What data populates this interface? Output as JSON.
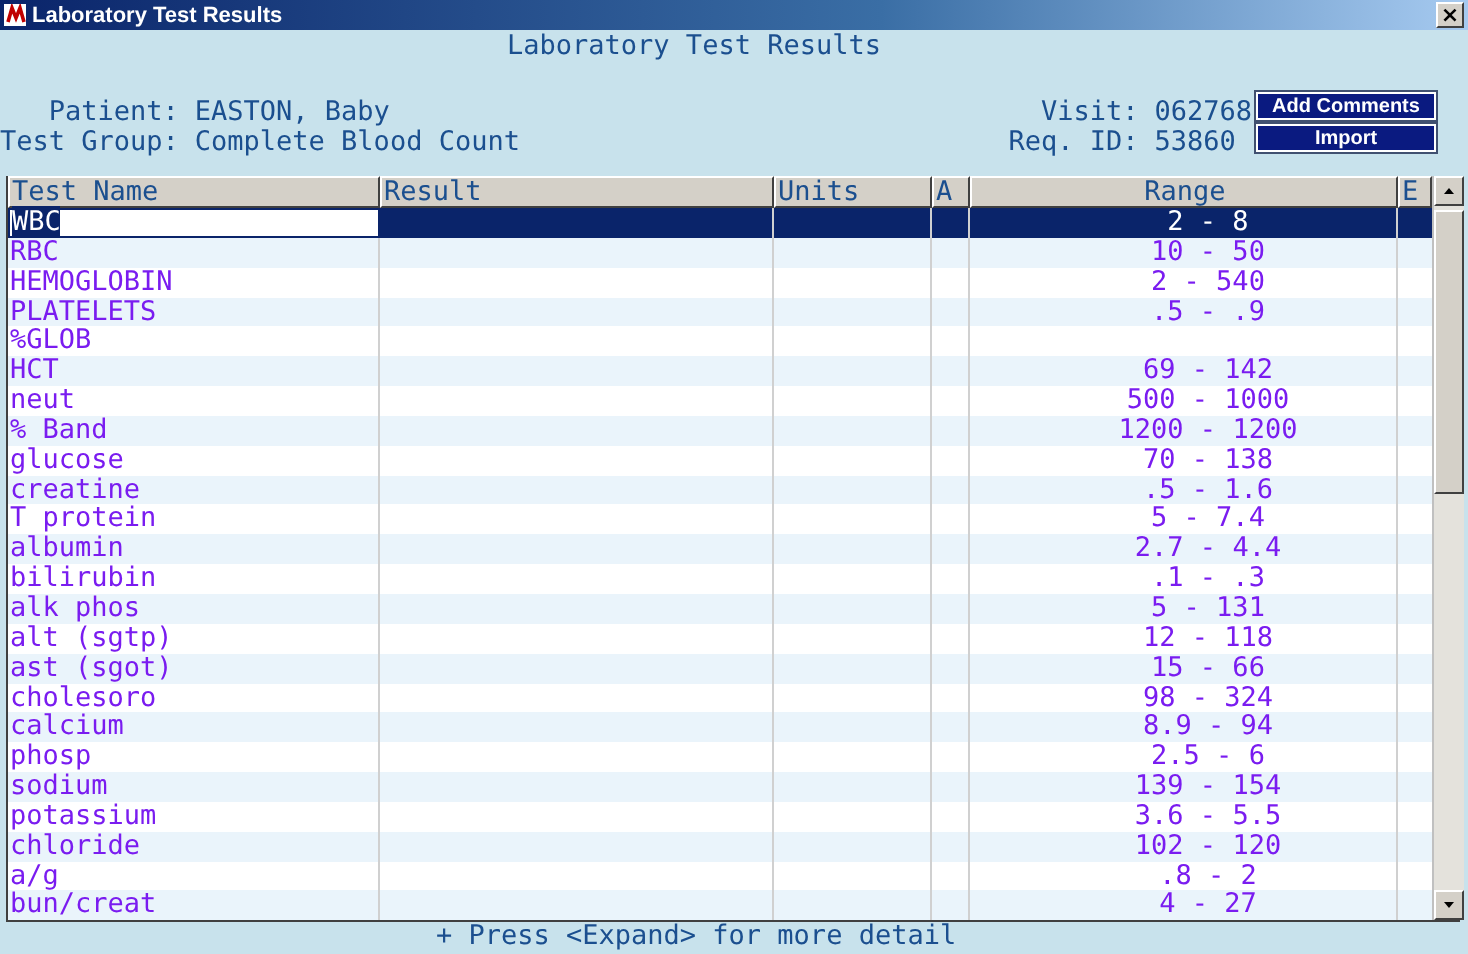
{
  "window": {
    "title": "Laboratory Test Results",
    "close": "×"
  },
  "header": {
    "title": "Laboratory Test Results",
    "patient_label": "Patient:",
    "patient": "EASTON, Baby",
    "group_label": "Test Group:",
    "group": "Complete Blood Count",
    "visit_label": "Visit:",
    "visit": "062768",
    "req_label": "Req. ID:",
    "req": "53860"
  },
  "buttons": [
    {
      "label": "Add Comments"
    },
    {
      "label": "Import"
    }
  ],
  "table": {
    "columns": [
      "Test Name",
      "Result",
      "Units",
      "A",
      "Range",
      "E"
    ],
    "rows": [
      {
        "name": "WBC",
        "range": "2 - 8",
        "selected": true
      },
      {
        "name": "RBC",
        "range": "10 - 50",
        "selected": false
      },
      {
        "name": "HEMOGLOBIN",
        "range": "2 - 540",
        "selected": false
      },
      {
        "name": "PLATELETS",
        "range": ".5 - .9",
        "selected": false
      },
      {
        "name": "%GLOB",
        "range": "",
        "selected": false
      },
      {
        "name": "HCT",
        "range": "69 - 142",
        "selected": false
      },
      {
        "name": "neut",
        "range": "500 - 1000",
        "selected": false
      },
      {
        "name": "% Band",
        "range": "1200 - 1200",
        "selected": false
      },
      {
        "name": "glucose",
        "range": "70 - 138",
        "selected": false
      },
      {
        "name": "creatine",
        "range": ".5 - 1.6",
        "selected": false
      },
      {
        "name": "T protein",
        "range": "5 - 7.4",
        "selected": false
      },
      {
        "name": "albumin",
        "range": "2.7 - 4.4",
        "selected": false
      },
      {
        "name": "bilirubin",
        "range": ".1 - .3",
        "selected": false
      },
      {
        "name": "alk phos",
        "range": "5 - 131",
        "selected": false
      },
      {
        "name": "alt (sgtp)",
        "range": "12 - 118",
        "selected": false
      },
      {
        "name": "ast (sgot)",
        "range": "15 - 66",
        "selected": false
      },
      {
        "name": "cholesoro",
        "range": "98 - 324",
        "selected": false
      },
      {
        "name": "calcium",
        "range": "8.9 - 94",
        "selected": false
      },
      {
        "name": "phosp",
        "range": "2.5 - 6",
        "selected": false
      },
      {
        "name": "sodium",
        "range": "139 - 154",
        "selected": false
      },
      {
        "name": "potassium",
        "range": "3.6 - 5.5",
        "selected": false
      },
      {
        "name": "chloride",
        "range": "102 - 120",
        "selected": false
      },
      {
        "name": "a/g",
        "range": ".8 - 2",
        "selected": false
      },
      {
        "name": "bun/creat",
        "range": "4 - 27",
        "selected": false
      }
    ]
  },
  "status_bar": "+ Press <Expand> for more detail"
}
